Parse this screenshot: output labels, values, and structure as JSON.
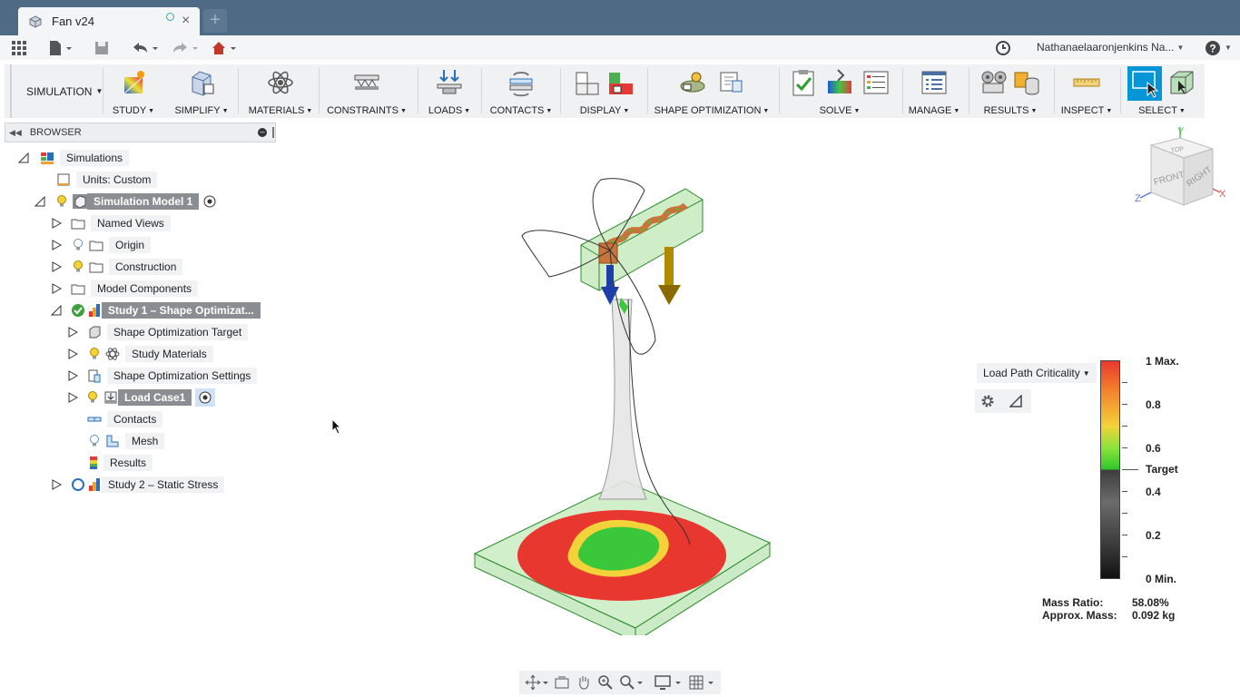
{
  "tab": {
    "title": "Fan v24",
    "close": "×",
    "new_tab": "+"
  },
  "quickbar": {
    "user": "Nathanaelaaronjenkins Na...",
    "help": "?"
  },
  "toolbar": {
    "workspace": "SIMULATION",
    "groups": [
      {
        "label": "STUDY"
      },
      {
        "label": "SIMPLIFY"
      },
      {
        "label": "MATERIALS"
      },
      {
        "label": "CONSTRAINTS"
      },
      {
        "label": "LOADS"
      },
      {
        "label": "CONTACTS"
      },
      {
        "label": "DISPLAY"
      },
      {
        "label": "SHAPE OPTIMIZATION"
      },
      {
        "label": "SOLVE"
      },
      {
        "label": "MANAGE"
      },
      {
        "label": "RESULTS"
      },
      {
        "label": "INSPECT"
      },
      {
        "label": "SELECT"
      }
    ],
    "caret": "▾"
  },
  "browser": {
    "title": "BROWSER",
    "nodes": [
      {
        "label": "Simulations"
      },
      {
        "label": "Units: Custom"
      },
      {
        "label": "Simulation Model 1"
      },
      {
        "label": "Named Views"
      },
      {
        "label": "Origin"
      },
      {
        "label": "Construction"
      },
      {
        "label": "Model Components"
      },
      {
        "label": "Study 1 – Shape Optimizat..."
      },
      {
        "label": "Shape Optimization Target"
      },
      {
        "label": "Study Materials"
      },
      {
        "label": "Shape Optimization Settings"
      },
      {
        "label": "Load Case1"
      },
      {
        "label": "Contacts"
      },
      {
        "label": "Mesh"
      },
      {
        "label": "Results"
      },
      {
        "label": "Study 2 – Static Stress"
      }
    ]
  },
  "viewcube": {
    "top": "TOP",
    "front": "FRONT",
    "right": "RIGHT",
    "x": "X",
    "y": "Y",
    "z": "Z"
  },
  "legend": {
    "dropdown": "Load Path Criticality",
    "labels": [
      "1 Max.",
      "0.8",
      "0.6",
      "Target",
      "0.4",
      "0.2",
      "0 Min."
    ],
    "mass_ratio_label": "Mass Ratio:",
    "mass_ratio_value": "58.08%",
    "approx_mass_label": "Approx. Mass:",
    "approx_mass_value": "0.092 kg"
  },
  "colors": {
    "tabbar": "#4f6a85",
    "selected": "#8a8d91",
    "accent": "#0696d7"
  }
}
